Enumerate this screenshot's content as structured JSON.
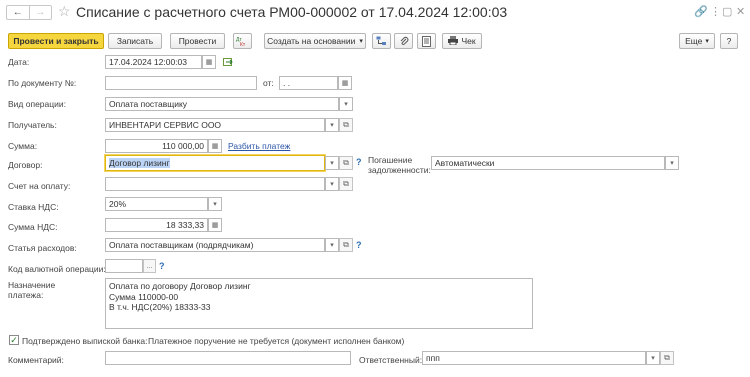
{
  "window": {
    "title": "Списание с расчетного счета РМ00-000002 от 17.04.2024 12:00:03",
    "nav_back": "←",
    "nav_forward": "→",
    "favorite_icon": "☆",
    "link_icon": "🔗",
    "more_icon": "⋮",
    "maximize_icon": "▢",
    "close_icon": "✕"
  },
  "toolbar": {
    "post_and_close": "Провести и закрыть",
    "save": "Записать",
    "post": "Провести",
    "create_based_on": "Создать на основании",
    "receipt": "Чек",
    "more": "Еще",
    "help": "?"
  },
  "form": {
    "date_label": "Дата:",
    "date_value": "17.04.2024 12:00:03",
    "doc_number_label": "По документу №:",
    "doc_number_value": "",
    "from_label": "от:",
    "from_value": " .  .",
    "operation_label": "Вид операции:",
    "operation_value": "Оплата поставщику",
    "recipient_label": "Получатель:",
    "recipient_value": "ИНВЕНТАРИ СЕРВИС ООО",
    "amount_label": "Сумма:",
    "amount_value": "110 000,00",
    "split_payment_link": "Разбить платеж",
    "contract_label": "Договор:",
    "contract_value": "Договор лизинг",
    "repayment_label": "Погашение задолженности:",
    "repayment_value": "Автоматически",
    "invoice_label": "Счет на оплату:",
    "invoice_value": "",
    "vat_rate_label": "Ставка НДС:",
    "vat_rate_value": "20%",
    "vat_amount_label": "Сумма НДС:",
    "vat_amount_value": "18 333,33",
    "expense_item_label": "Статья расходов:",
    "expense_item_value": "Оплата поставщикам (подрядчикам)",
    "currency_op_label": "Код валютной операции:",
    "currency_op_value": "",
    "purpose_label": "Назначение платежа:",
    "purpose_lines": [
      "Оплата по договору Договор лизинг",
      "Сумма 110000-00",
      "В т.ч. НДС(20%) 18333-33"
    ],
    "bank_confirmed_label": "Подтверждено выпиской банка:",
    "bank_confirmed_checked": true,
    "payment_order_note": "Платежное поручение не требуется (документ исполнен банком)",
    "comment_label": "Комментарий:",
    "comment_value": "",
    "responsible_label": "Ответственный:",
    "responsible_value": "ппп",
    "help_mark": "?",
    "open_icon": "⧉",
    "dropdown_icon": "▾",
    "calendar_icon": "▦",
    "ellipsis_icon": "...",
    "checkmark": "✓"
  }
}
